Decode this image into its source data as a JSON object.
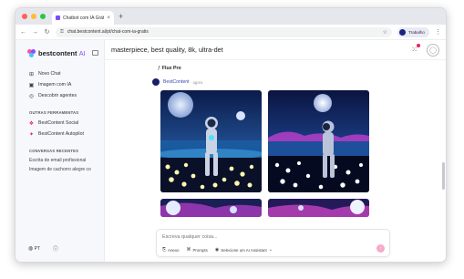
{
  "browser": {
    "tab_title": "Chatbot com IA Grátis | Ultra",
    "tab_close": "×",
    "new_tab": "+",
    "url": "chat.bestcontent.ai/pt/chat-com-ia-gratis",
    "profile_label": "Trabalho",
    "icons": {
      "back": "arrow-left-icon",
      "forward": "arrow-right-icon",
      "reload": "reload-icon",
      "lock": "lock-icon",
      "star": "star-icon",
      "menu": "kebab-icon"
    }
  },
  "sidebar": {
    "brand_name": "bestcontent",
    "brand_suffix": "AI",
    "nav_items": [
      {
        "label": "Novo Chat",
        "icon": "plus-square-icon"
      },
      {
        "label": "Imagem com IA",
        "icon": "image-icon"
      },
      {
        "label": "Descobrir agentes",
        "icon": "compass-icon"
      }
    ],
    "tools_section": "OUTRAS FERRAMENTAS",
    "tool_items": [
      {
        "label": "BestContent Social",
        "icon": "social-icon"
      },
      {
        "label": "BestContent Autopilot",
        "icon": "autopilot-icon"
      }
    ],
    "recent_section": "CONVERSAS RECENTES",
    "recent_items": [
      "Escrita de email profissional",
      "Imagem de cachorro alegre co"
    ],
    "language": "PT"
  },
  "header": {
    "prompt_title": "masterpiece, best quality, 8k, ultra-det"
  },
  "chat": {
    "model_name": "Flux Pro",
    "bot_name": "BestContent",
    "bot_time": "agora",
    "images": [
      "astronaut-moon-lake-image-1",
      "astronaut-moon-lake-image-2",
      "astronaut-moon-lake-image-3",
      "astronaut-moon-lake-image-4"
    ]
  },
  "composer": {
    "placeholder": "Escreva qualquer coisa...",
    "attach_label": "Anexo",
    "prompts_label": "Prompts",
    "assistant_label": "Selecione um AI Assistant"
  },
  "colors": {
    "brand_purple": "#8a4dff",
    "send_pink": "#f7a9c9",
    "bot_name_blue": "#3949ab"
  }
}
